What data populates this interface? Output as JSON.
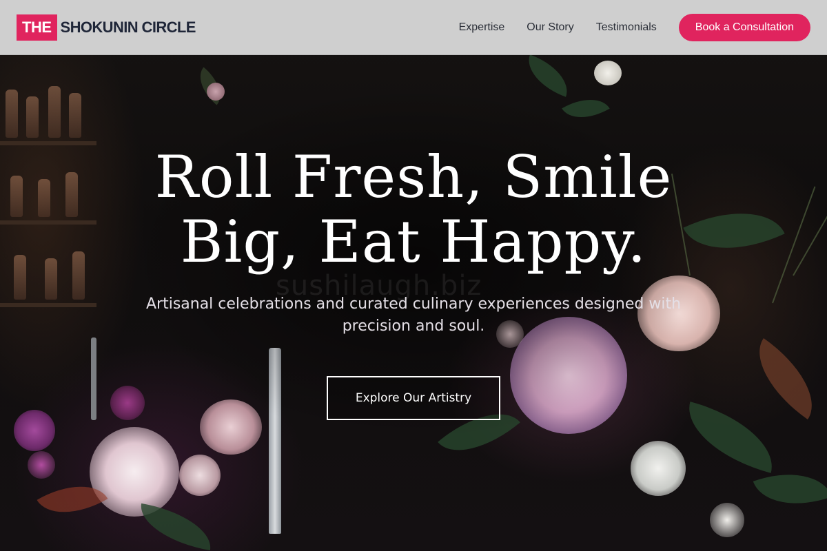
{
  "brand": {
    "badge": "THE",
    "name": "SHOKUNIN CIRCLE"
  },
  "nav": {
    "links": [
      "Expertise",
      "Our Story",
      "Testimonials"
    ],
    "cta_label": "Book a Consultation"
  },
  "hero": {
    "title": "Roll Fresh, Smile Big, Eat Happy.",
    "subtitle": "Artisanal celebrations and curated culinary experiences designed with precision and soul.",
    "button_label": "Explore Our Artistry",
    "watermark": "sushilaugh.biz"
  },
  "colors": {
    "accent": "#e0245e",
    "nav_background": "#d6d6d6",
    "logo_text": "#1f2638",
    "hero_text": "#ffffff"
  }
}
